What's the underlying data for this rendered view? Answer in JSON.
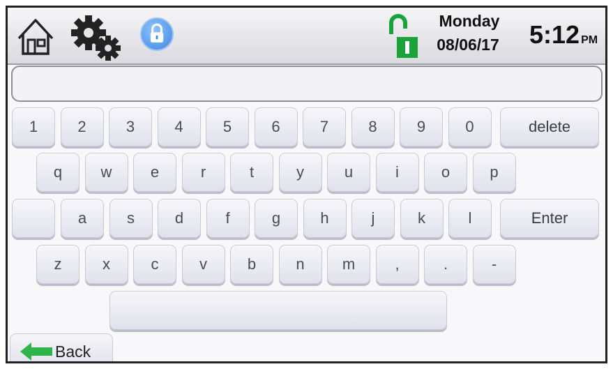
{
  "status": {
    "day": "Monday",
    "date": "08/06/17",
    "time": "5:12",
    "ampm": "PM",
    "lock_state_color": "#19a33a"
  },
  "icons": [
    "home-icon",
    "gear-icon",
    "lock-icon",
    "unlock-status-icon",
    "back-arrow-icon"
  ],
  "entry": {
    "value": ""
  },
  "keyboard": {
    "row1": [
      "1",
      "2",
      "3",
      "4",
      "5",
      "6",
      "7",
      "8",
      "9",
      "0"
    ],
    "delete_label": "delete",
    "row2": [
      "q",
      "w",
      "e",
      "r",
      "t",
      "y",
      "u",
      "i",
      "o",
      "p"
    ],
    "row3": [
      "a",
      "s",
      "d",
      "f",
      "g",
      "h",
      "j",
      "k",
      "l"
    ],
    "enter_label": "Enter",
    "row4": [
      "z",
      "x",
      "c",
      "v",
      "b",
      "n",
      "m",
      ",",
      ".",
      "-"
    ],
    "space_label": ""
  },
  "back_label": "Back",
  "colors": {
    "accent_blue": "#3f86e0",
    "back_arrow": "#2fb34a"
  }
}
